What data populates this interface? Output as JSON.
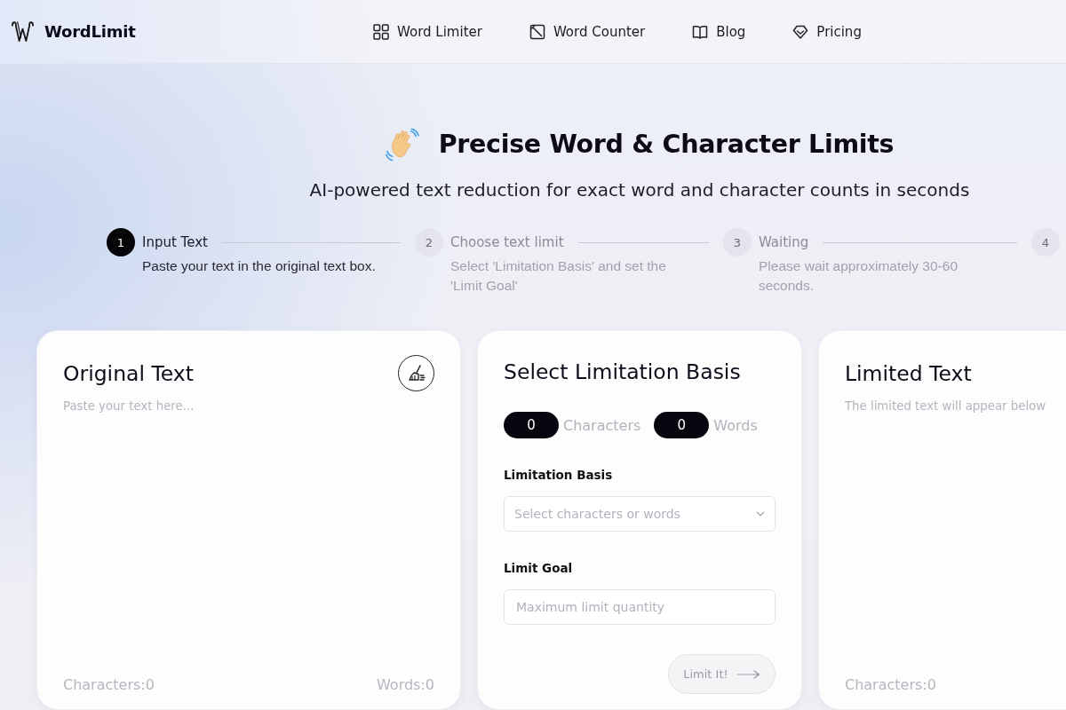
{
  "header": {
    "logo": "WordLimit",
    "nav": [
      {
        "label": "Word Limiter"
      },
      {
        "label": "Word Counter"
      },
      {
        "label": "Blog"
      },
      {
        "label": "Pricing"
      }
    ]
  },
  "hero": {
    "title": "Precise Word & Character Limits",
    "subtitle": "AI-powered text reduction for exact word and character counts in seconds"
  },
  "steps": [
    {
      "number": "1",
      "title": "Input Text",
      "description": "Paste your text in the original text box.",
      "selected": true
    },
    {
      "number": "2",
      "title": "Choose text limit",
      "description": "Select 'Limitation Basis' and set the 'Limit Goal'",
      "selected": false
    },
    {
      "number": "3",
      "title": "Waiting",
      "description": "Please wait approximately 30-60 seconds.",
      "selected": false
    },
    {
      "number": "4",
      "selected": false
    }
  ],
  "original_panel": {
    "title": "Original Text",
    "placeholder": "Paste your text here...",
    "characters": "Characters:0",
    "words": "Words:0"
  },
  "settings_panel": {
    "title": "Select Limitation Basis",
    "counts": [
      {
        "value": "0",
        "label": "Characters"
      },
      {
        "value": "0",
        "label": "Words"
      }
    ],
    "basis": {
      "label": "Limitation Basis",
      "placeholder": "Select characters or words"
    },
    "goal": {
      "label": "Limit Goal",
      "placeholder": "Maximum limit quantity"
    },
    "button": {
      "label": "Limit It!",
      "disabled": true
    }
  },
  "result_panel": {
    "title": "Limited Text",
    "placeholder": "The limited text will appear below",
    "characters": "Characters:0"
  }
}
